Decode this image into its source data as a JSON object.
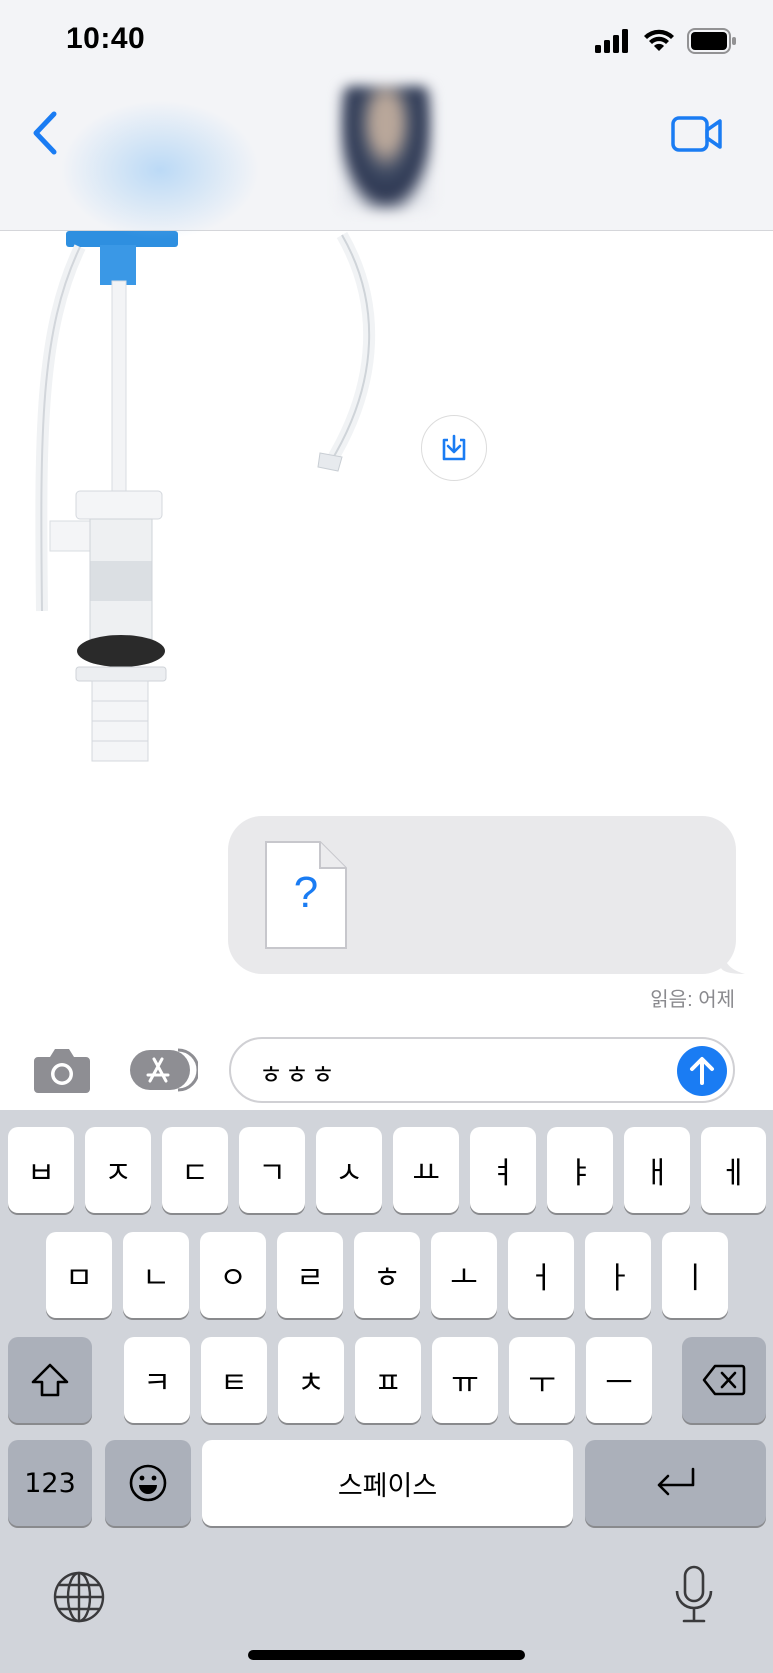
{
  "status_bar": {
    "time": "10:40"
  },
  "nav": {
    "back_icon": "chevron-left-icon",
    "video_icon": "video-camera-icon",
    "accent_color": "#1a7cf3"
  },
  "chat": {
    "save_icon": "download-icon",
    "attachment": {
      "glyph": "?"
    },
    "read_receipt": "읽음: 어제"
  },
  "input_bar": {
    "message_text": "ㅎㅎㅎ",
    "camera_icon": "camera-icon",
    "appstore_icon": "app-store-icon",
    "send_icon": "arrow-up-icon"
  },
  "keyboard": {
    "row1": [
      "ㅂ",
      "ㅈ",
      "ㄷ",
      "ㄱ",
      "ㅅ",
      "ㅛ",
      "ㅕ",
      "ㅑ",
      "ㅐ",
      "ㅔ"
    ],
    "row2": [
      "ㅁ",
      "ㄴ",
      "ㅇ",
      "ㄹ",
      "ㅎ",
      "ㅗ",
      "ㅓ",
      "ㅏ",
      "ㅣ"
    ],
    "row3": [
      "ㅋ",
      "ㅌ",
      "ㅊ",
      "ㅍ",
      "ㅠ",
      "ㅜ",
      "ㅡ"
    ],
    "numbers_key": "123",
    "space_key": "스페이스",
    "shift_icon": "shift-icon",
    "delete_icon": "backspace-icon",
    "emoji_icon": "emoji-icon",
    "return_icon": "return-icon",
    "globe_icon": "globe-icon",
    "mic_icon": "microphone-icon"
  }
}
